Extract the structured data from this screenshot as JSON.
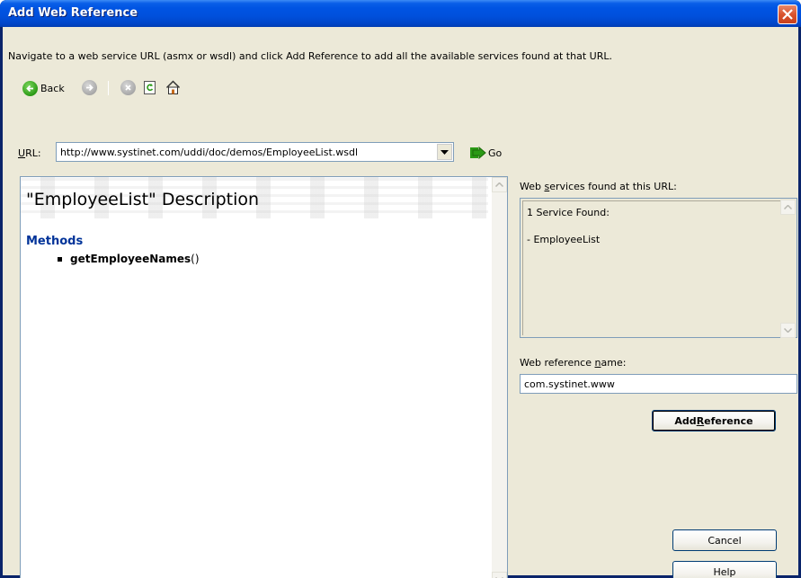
{
  "window": {
    "title": "Add Web Reference"
  },
  "instructions": "Navigate to a web service URL (asmx or wsdl) and click Add Reference to add all the available services found at that URL.",
  "toolbar": {
    "back_label": "Back",
    "icons": [
      "back-arrow-icon",
      "forward-arrow-icon",
      "stop-icon",
      "refresh-icon",
      "home-icon"
    ]
  },
  "url": {
    "label_prefix": "",
    "label_accel": "U",
    "label_rest": "RL:",
    "value": "http://www.systinet.com/uddi/doc/demos/EmployeeList.wsdl",
    "go_label": "Go"
  },
  "browser": {
    "title": "\"EmployeeList\" Description",
    "methods_heading": "Methods",
    "methods": [
      {
        "name": "getEmployeeNames",
        "suffix": "()"
      }
    ]
  },
  "services": {
    "label_prefix": "Web ",
    "label_accel": "s",
    "label_rest": "ervices found at this URL:",
    "line1": "1 Service Found:",
    "line2": "- EmployeeList"
  },
  "reference_name": {
    "label_prefix": "Web reference ",
    "label_accel": "n",
    "label_rest": "ame:",
    "value": "com.systinet.www"
  },
  "buttons": {
    "add_reference_prefix": "Add ",
    "add_reference_accel": "R",
    "add_reference_rest": "eference",
    "cancel": "Cancel",
    "help": "Help"
  },
  "colors": {
    "titlebar": "#0054e3",
    "dialog_bg": "#ece9d8",
    "methods_heading": "#003399",
    "close_button": "#d9542f",
    "go_arrow": "#2b9a16"
  }
}
